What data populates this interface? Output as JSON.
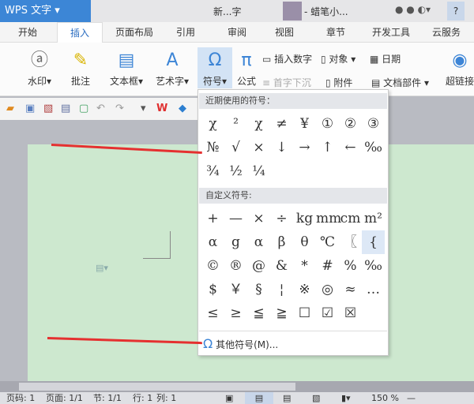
{
  "title": {
    "app": "WPS 文字",
    "doc": "新...字",
    "user": "- 蜡笔小...",
    "help": "?"
  },
  "tabs": [
    "开始",
    "插入",
    "页面布局",
    "引用",
    "审阅",
    "视图",
    "章节",
    "开发工具",
    "云服务"
  ],
  "ribbon": {
    "watermark": "水印",
    "comment": "批注",
    "textbox": "文本框",
    "wordart": "艺术字",
    "symbol": "符号",
    "formula": "公式",
    "insert_number": "插入数字",
    "object": "对象",
    "date": "日期",
    "drop_cap": "首字下沉",
    "attachment": "附件",
    "doc_parts": "文档部件",
    "hyperlink": "超链接"
  },
  "symbol_menu": {
    "recent_header": "近期使用的符号：",
    "recent": [
      "χ",
      "²",
      "χ",
      "≠",
      "¥",
      "①",
      "②",
      "③",
      "№",
      "√",
      "×",
      "↓",
      "→",
      "↑",
      "←",
      "‰",
      "¾",
      "½",
      "¼"
    ],
    "custom_header": "自定义符号:",
    "custom": [
      "+",
      "—",
      "×",
      "÷",
      "kg",
      "mm",
      "cm",
      "m²",
      "α",
      "g",
      "α",
      "β",
      "θ",
      "℃",
      "〖",
      "{",
      "©",
      "®",
      "@",
      "&",
      "*",
      "#",
      "%",
      "‰",
      "$",
      "￥",
      "§",
      "¦",
      "※",
      "◎",
      "≈",
      "…",
      "≤",
      "≥",
      "≦",
      "≧",
      "☐",
      "☑",
      "☒"
    ],
    "other": "其他符号(M)..."
  },
  "status": {
    "page": "页码: 1",
    "pages": "页面: 1/1",
    "section": "节: 1/1",
    "row": "行: 1",
    "col": "列: 1",
    "zoom": "150 %"
  }
}
